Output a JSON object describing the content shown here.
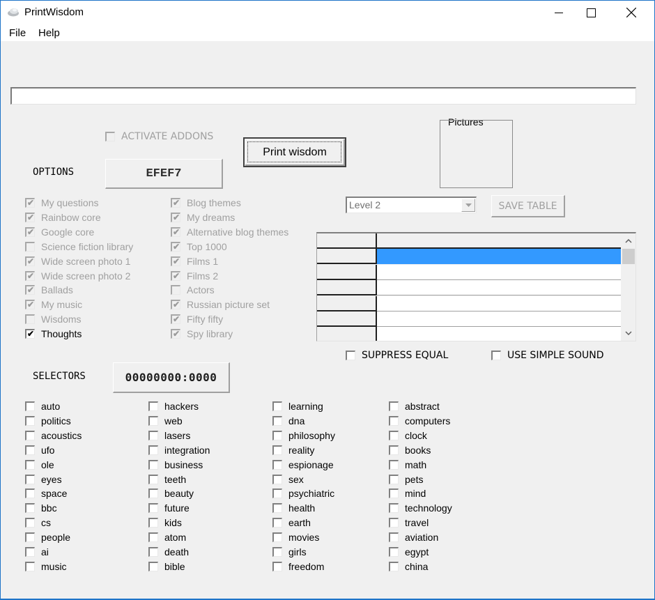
{
  "window": {
    "title": "PrintWisdom",
    "controls": {
      "minimize": "minimize",
      "maximize": "maximize",
      "close": "close"
    }
  },
  "menu": {
    "items": [
      {
        "label": "File"
      },
      {
        "label": "Help"
      }
    ]
  },
  "main": {
    "text_value": "",
    "activate_addons": {
      "label": "ACTIVATE ADDONS",
      "checked": false,
      "enabled": false
    },
    "print_button": {
      "label": "Print wisdom"
    },
    "options_label": "OPTIONS",
    "options_code": "EFEF7",
    "pictures_label": "Pictures",
    "level_select": {
      "value": "Level 2"
    },
    "save_table_label": "SAVE TABLE",
    "suppress_equal": {
      "label": "SUPPRESS EQUAL",
      "checked": false
    },
    "use_simple_sound": {
      "label": "USE SIMPLE SOUND",
      "checked": false
    },
    "selectors_label": "SELECTORS",
    "selectors_code": "00000000:0000",
    "grid": {
      "rows": 6,
      "selected_row": 1
    }
  },
  "libraries": {
    "col1": [
      {
        "label": "My questions",
        "checked": true,
        "enabled": false
      },
      {
        "label": "Rainbow core",
        "checked": true,
        "enabled": false
      },
      {
        "label": "Google core",
        "checked": true,
        "enabled": false
      },
      {
        "label": "Science fiction library",
        "checked": false,
        "enabled": false
      },
      {
        "label": "Wide screen photo 1",
        "checked": true,
        "enabled": false
      },
      {
        "label": "Wide screen photo 2",
        "checked": true,
        "enabled": false
      },
      {
        "label": "Ballads",
        "checked": true,
        "enabled": false
      },
      {
        "label": "My music",
        "checked": true,
        "enabled": false
      },
      {
        "label": "Wisdoms",
        "checked": false,
        "enabled": false
      },
      {
        "label": "Thoughts",
        "checked": true,
        "enabled": true
      }
    ],
    "col2": [
      {
        "label": "Blog themes",
        "checked": true,
        "enabled": false
      },
      {
        "label": "My dreams",
        "checked": true,
        "enabled": false
      },
      {
        "label": "Alternative blog themes",
        "checked": true,
        "enabled": false
      },
      {
        "label": "Top 1000",
        "checked": true,
        "enabled": false
      },
      {
        "label": "Films 1",
        "checked": true,
        "enabled": false
      },
      {
        "label": "Films 2",
        "checked": true,
        "enabled": false
      },
      {
        "label": "Actors",
        "checked": false,
        "enabled": false
      },
      {
        "label": "Russian picture set",
        "checked": true,
        "enabled": false
      },
      {
        "label": "Fifty fifty",
        "checked": true,
        "enabled": false
      },
      {
        "label": "Spy library",
        "checked": true,
        "enabled": false
      }
    ]
  },
  "selectors": {
    "col1": [
      "auto",
      "politics",
      "acoustics",
      "ufo",
      "ole",
      "eyes",
      "space",
      "bbc",
      "cs",
      "people",
      "ai",
      "music"
    ],
    "col2": [
      "hackers",
      "web",
      "lasers",
      "integration",
      "business",
      "teeth",
      "beauty",
      "future",
      "kids",
      "atom",
      "death",
      "bible"
    ],
    "col3": [
      "learning",
      "dna",
      "philosophy",
      "reality",
      "espionage",
      "sex",
      "psychiatric",
      "health",
      "earth",
      "movies",
      "girls",
      "freedom"
    ],
    "col4": [
      "abstract",
      "computers",
      "clock",
      "books",
      "math",
      "pets",
      "mind",
      "technology",
      "travel",
      "aviation",
      "egypt",
      "china"
    ]
  },
  "colors": {
    "selection": "#3399ff",
    "window_border": "#1e73c8",
    "client_bg": "#f0f0f0"
  }
}
